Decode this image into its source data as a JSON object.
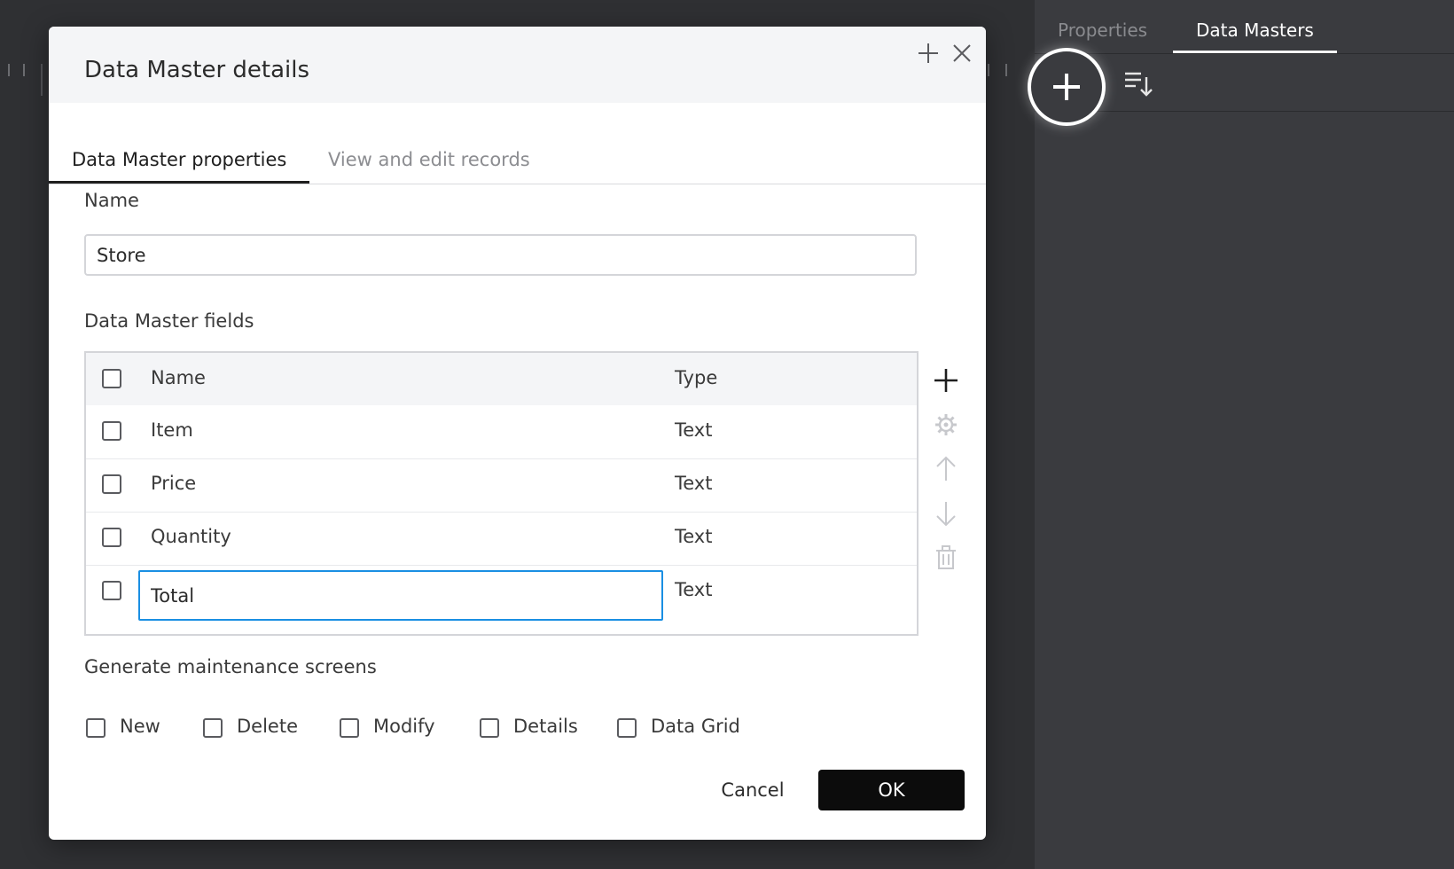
{
  "right_panel": {
    "tabs": [
      {
        "label": "Properties",
        "active": false
      },
      {
        "label": "Data Masters",
        "active": true
      }
    ],
    "add_icon": "plus-icon",
    "sort_icon": "sort-descending-icon"
  },
  "dialog": {
    "title": "Data Master details",
    "header_icons": [
      "maximize-plus-icon",
      "close-icon"
    ],
    "tabs": [
      {
        "label": "Data Master properties",
        "active": true
      },
      {
        "label": "View and edit records",
        "active": false
      }
    ],
    "name_label": "Name",
    "name_value": "Store",
    "fields_label": "Data Master fields",
    "table": {
      "headers": {
        "name": "Name",
        "type": "Type"
      },
      "rows": [
        {
          "name": "Item",
          "type": "Text"
        },
        {
          "name": "Price",
          "type": "Text"
        },
        {
          "name": "Quantity",
          "type": "Text"
        },
        {
          "name": "Total",
          "type": "Text",
          "editing": true
        }
      ]
    },
    "side_tools": [
      "plus-icon",
      "gear-icon",
      "arrow-up-icon",
      "arrow-down-icon",
      "trash-icon"
    ],
    "generate_label": "Generate maintenance screens",
    "generate_options": [
      "New",
      "Delete",
      "Modify",
      "Details",
      "Data Grid"
    ],
    "cancel_label": "Cancel",
    "ok_label": "OK"
  },
  "colors": {
    "app_background": "#2f3033",
    "panel_background": "#3a3b3f",
    "edit_focus": "#1a8fe3",
    "primary_button": "#0c0c0c"
  }
}
